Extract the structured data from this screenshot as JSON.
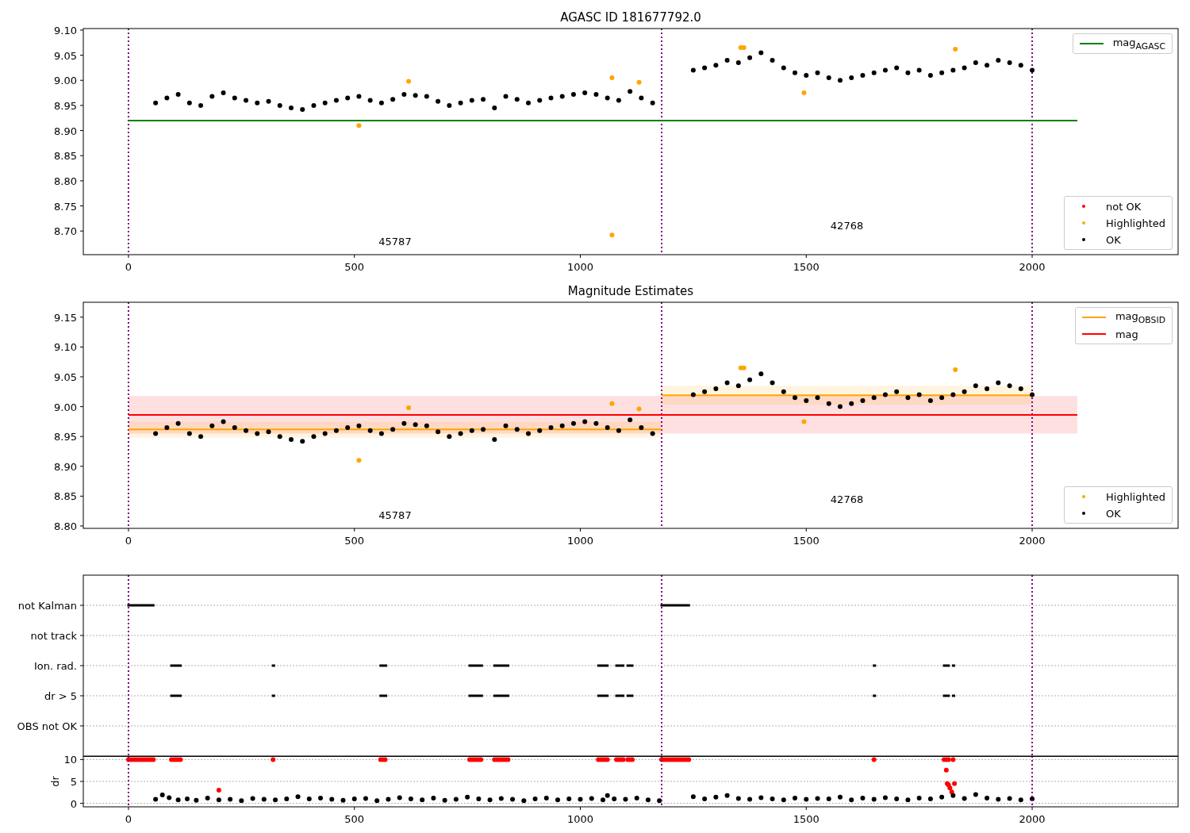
{
  "figure": {
    "panels": [
      {
        "title": "AGASC ID 181677792.0",
        "chart_data": {
          "type": "scatter",
          "legend": [
            "upper right",
            "lower right"
          ],
          "xlim": [
            -100,
            2323
          ],
          "ylim": [
            8.653,
            9.103
          ],
          "xticks": [
            0,
            500,
            1000,
            1500,
            2000
          ],
          "yticks": [
            {
              "value": 8.7,
              "label": "8.70"
            },
            {
              "value": 8.75,
              "label": "8.75"
            },
            {
              "value": 8.8,
              "label": "8.80"
            },
            {
              "value": 8.85,
              "label": "8.85"
            },
            {
              "value": 8.9,
              "label": "8.90"
            },
            {
              "value": 8.95,
              "label": "8.95"
            },
            {
              "value": 9.0,
              "label": "9.00"
            },
            {
              "value": 9.05,
              "label": "9.05"
            },
            {
              "value": 9.1,
              "label": "9.10"
            }
          ],
          "series": [
            {
              "name": "mag$_{AGASC}$",
              "type": "line",
              "color": "#008000",
              "x": [
                0,
                2100
              ],
              "values": [
                8.92,
                8.92
              ]
            },
            {
              "name": "not OK",
              "color": "#ff0000"
            },
            {
              "name": "Highlighted",
              "color": "#ffa500",
              "x": [
                510,
                620,
                1070,
                1070,
                1130,
                1355,
                1362,
                1495,
                1830
              ],
              "values": [
                8.91,
                8.998,
                9.005,
                8.692,
                8.996,
                9.065,
                9.065,
                8.975,
                9.062
              ]
            },
            {
              "name": "OK",
              "color": "#000000",
              "x": [
                60,
                85,
                110,
                135,
                160,
                185,
                210,
                235,
                260,
                285,
                310,
                335,
                360,
                385,
                410,
                435,
                460,
                485,
                510,
                535,
                560,
                585,
                610,
                635,
                660,
                685,
                710,
                735,
                760,
                785,
                810,
                835,
                860,
                885,
                910,
                935,
                960,
                985,
                1010,
                1035,
                1060,
                1085,
                1110,
                1135,
                1160,
                1250,
                1275,
                1300,
                1325,
                1350,
                1375,
                1400,
                1425,
                1450,
                1475,
                1500,
                1525,
                1550,
                1575,
                1600,
                1625,
                1650,
                1675,
                1700,
                1725,
                1750,
                1775,
                1800,
                1825,
                1850,
                1875,
                1900,
                1925,
                1950,
                1975,
                2000
              ],
              "values": [
                8.955,
                8.965,
                8.972,
                8.955,
                8.95,
                8.968,
                8.975,
                8.965,
                8.96,
                8.955,
                8.958,
                8.95,
                8.945,
                8.942,
                8.95,
                8.955,
                8.96,
                8.965,
                8.968,
                8.96,
                8.955,
                8.962,
                8.972,
                8.97,
                8.968,
                8.958,
                8.95,
                8.955,
                8.96,
                8.962,
                8.945,
                8.968,
                8.962,
                8.955,
                8.96,
                8.965,
                8.968,
                8.972,
                8.975,
                8.972,
                8.965,
                8.96,
                8.978,
                8.965,
                8.955,
                9.02,
                9.025,
                9.03,
                9.04,
                9.035,
                9.045,
                9.055,
                9.04,
                9.025,
                9.015,
                9.01,
                9.015,
                9.005,
                9.0,
                9.005,
                9.01,
                9.015,
                9.02,
                9.025,
                9.015,
                9.02,
                9.01,
                9.015,
                9.02,
                9.025,
                9.035,
                9.03,
                9.04,
                9.035,
                9.03,
                9.02
              ]
            }
          ],
          "ref_lines": [
            {
              "axis": "x",
              "value": 0,
              "color": "#800080"
            },
            {
              "axis": "x",
              "value": 1180,
              "color": "#800080"
            },
            {
              "axis": "x",
              "value": 2000,
              "color": "#800080"
            }
          ],
          "annotations": [
            "45787",
            "42768"
          ]
        }
      },
      {
        "title": "Magnitude Estimates",
        "chart_data": {
          "type": "scatter",
          "legend": [
            "upper right",
            "lower right"
          ],
          "xlim": [
            -100,
            2323
          ],
          "ylim": [
            8.796,
            9.175
          ],
          "xticks": [
            0,
            500,
            1000,
            1500,
            2000
          ],
          "yticks": [
            {
              "value": 8.8,
              "label": "8.80"
            },
            {
              "value": 8.85,
              "label": "8.85"
            },
            {
              "value": 8.9,
              "label": "8.90"
            },
            {
              "value": 8.95,
              "label": "8.95"
            },
            {
              "value": 9.0,
              "label": "9.00"
            },
            {
              "value": 9.05,
              "label": "9.05"
            },
            {
              "value": 9.1,
              "label": "9.10"
            },
            {
              "value": 9.15,
              "label": "9.15"
            }
          ],
          "series": [
            {
              "name": "mag$_{OBSID}$",
              "type": "line",
              "color": "#ffa500",
              "x": [
                0,
                1180,
                1180,
                2000
              ],
              "values": [
                8.962,
                8.962,
                9.019,
                9.019
              ]
            },
            {
              "name": "mag",
              "type": "line",
              "color": "#ff0000",
              "x": [
                0,
                2100
              ],
              "values": [
                8.986,
                8.986
              ]
            },
            {
              "name": "Highlighted",
              "color": "#ffa500",
              "x": [
                510,
                620,
                1070,
                1130,
                1355,
                1362,
                1495,
                1830
              ],
              "values": [
                8.91,
                8.998,
                9.005,
                8.996,
                9.065,
                9.065,
                8.975,
                9.062
              ]
            },
            {
              "name": "OK",
              "color": "#000000",
              "x": [
                60,
                85,
                110,
                135,
                160,
                185,
                210,
                235,
                260,
                285,
                310,
                335,
                360,
                385,
                410,
                435,
                460,
                485,
                510,
                535,
                560,
                585,
                610,
                635,
                660,
                685,
                710,
                735,
                760,
                785,
                810,
                835,
                860,
                885,
                910,
                935,
                960,
                985,
                1010,
                1035,
                1060,
                1085,
                1110,
                1135,
                1160,
                1250,
                1275,
                1300,
                1325,
                1350,
                1375,
                1400,
                1425,
                1450,
                1475,
                1500,
                1525,
                1550,
                1575,
                1600,
                1625,
                1650,
                1675,
                1700,
                1725,
                1750,
                1775,
                1800,
                1825,
                1850,
                1875,
                1900,
                1925,
                1950,
                1975,
                2000
              ],
              "values": [
                8.955,
                8.965,
                8.972,
                8.955,
                8.95,
                8.968,
                8.975,
                8.965,
                8.96,
                8.955,
                8.958,
                8.95,
                8.945,
                8.942,
                8.95,
                8.955,
                8.96,
                8.965,
                8.968,
                8.96,
                8.955,
                8.962,
                8.972,
                8.97,
                8.968,
                8.958,
                8.95,
                8.955,
                8.96,
                8.962,
                8.945,
                8.968,
                8.962,
                8.955,
                8.96,
                8.965,
                8.968,
                8.972,
                8.975,
                8.972,
                8.965,
                8.96,
                8.978,
                8.965,
                8.955,
                9.02,
                9.025,
                9.03,
                9.04,
                9.035,
                9.045,
                9.055,
                9.04,
                9.025,
                9.015,
                9.01,
                9.015,
                9.005,
                9.0,
                9.005,
                9.01,
                9.015,
                9.02,
                9.025,
                9.015,
                9.02,
                9.01,
                9.015,
                9.02,
                9.025,
                9.035,
                9.03,
                9.04,
                9.035,
                9.03,
                9.02
              ]
            }
          ],
          "bands": [
            {
              "axis": "y",
              "from": 8.955,
              "to": 9.018,
              "color": "#ff0000"
            },
            {
              "axis": "y",
              "from": 8.948,
              "to": 8.975,
              "color": "#ffa500"
            },
            {
              "axis": "y",
              "from": 9.003,
              "to": 9.035,
              "color": "#ffa500"
            }
          ],
          "ref_lines": [
            {
              "axis": "x",
              "value": 0,
              "color": "#800080"
            },
            {
              "axis": "x",
              "value": 1180,
              "color": "#800080"
            },
            {
              "axis": "x",
              "value": 2000,
              "color": "#800080"
            }
          ],
          "annotations": [
            "45787",
            "42768"
          ]
        }
      }
    ],
    "flags": {
      "labels": [
        "not Kalman",
        "not track",
        "Ion. rad.",
        "dr > 5",
        "OBS not OK"
      ]
    },
    "dr": {
      "chart_data": {
        "type": "scatter",
        "grid": true,
        "ylabel": "dr",
        "xlim": [
          -100,
          2323
        ],
        "ylim": [
          -0.8,
          10.8
        ],
        "xticks": [
          0,
          500,
          1000,
          1500,
          2000
        ],
        "yticks": [
          0,
          5,
          10
        ],
        "series": [
          {
            "color": "#ff0000",
            "x": [
              0,
              5,
              10,
              15,
              20,
              25,
              30,
              35,
              40,
              45,
              50,
              55,
              95,
              100,
              105,
              110,
              115,
              320,
              558,
              563,
              568,
              755,
              760,
              765,
              770,
              775,
              780,
              810,
              815,
              820,
              825,
              830,
              835,
              840,
              1040,
              1045,
              1050,
              1055,
              1060,
              1080,
              1085,
              1090,
              1095,
              1105,
              1110,
              1115,
              1180,
              1185,
              1190,
              1195,
              1200,
              1205,
              1210,
              1215,
              1220,
              1225,
              1230,
              1235,
              1240,
              1650,
              1805,
              1810,
              1815,
              1825,
              200,
              1810,
              1812,
              1815,
              1818,
              1822,
              1828
            ],
            "values": [
              10,
              10,
              10,
              10,
              10,
              10,
              10,
              10,
              10,
              10,
              10,
              10,
              10,
              10,
              10,
              10,
              10,
              10,
              10,
              10,
              10,
              10,
              10,
              10,
              10,
              10,
              10,
              10,
              10,
              10,
              10,
              10,
              10,
              10,
              10,
              10,
              10,
              10,
              10,
              10,
              10,
              10,
              10,
              10,
              10,
              10,
              10,
              10,
              10,
              10,
              10,
              10,
              10,
              10,
              10,
              10,
              10,
              10,
              10,
              10,
              10,
              10,
              10,
              10,
              3,
              7.6,
              4.5,
              4.2,
              3.5,
              2.6,
              4.5
            ]
          },
          {
            "color": "#000000",
            "x": [
              60,
              75,
              90,
              110,
              130,
              150,
              175,
              200,
              225,
              250,
              275,
              300,
              325,
              350,
              375,
              400,
              425,
              450,
              475,
              500,
              525,
              550,
              575,
              600,
              625,
              650,
              675,
              700,
              725,
              750,
              775,
              800,
              825,
              850,
              875,
              900,
              925,
              950,
              975,
              1000,
              1025,
              1050,
              1060,
              1075,
              1100,
              1125,
              1150,
              1175,
              1250,
              1275,
              1300,
              1325,
              1350,
              1375,
              1400,
              1425,
              1450,
              1475,
              1500,
              1525,
              1550,
              1575,
              1600,
              1625,
              1650,
              1675,
              1700,
              1725,
              1750,
              1775,
              1800,
              1825,
              1850,
              1875,
              1900,
              1925,
              1950,
              1975,
              2000
            ],
            "values": [
              0.9,
              1.9,
              1.3,
              0.8,
              1.0,
              0.7,
              1.2,
              0.8,
              0.9,
              0.6,
              1.1,
              0.9,
              0.8,
              1.0,
              1.5,
              1.0,
              1.2,
              0.9,
              0.7,
              1.0,
              1.1,
              0.6,
              0.9,
              1.3,
              1.0,
              0.8,
              1.2,
              0.7,
              0.9,
              1.4,
              1.0,
              0.8,
              1.1,
              0.9,
              0.6,
              1.0,
              1.2,
              0.8,
              1.0,
              0.9,
              1.1,
              0.8,
              1.8,
              1.0,
              0.9,
              1.2,
              0.8,
              0.6,
              1.5,
              1.0,
              1.4,
              1.8,
              1.1,
              0.9,
              1.3,
              1.0,
              0.8,
              1.2,
              0.9,
              1.1,
              1.0,
              1.4,
              0.8,
              1.2,
              0.9,
              1.3,
              1.0,
              0.8,
              1.2,
              1.0,
              1.4,
              1.8,
              1.1,
              2.0,
              1.2,
              0.9,
              1.1,
              0.8,
              1.0
            ]
          }
        ],
        "ref_lines": [
          {
            "axis": "x",
            "value": 0,
            "color": "#800080"
          },
          {
            "axis": "x",
            "value": 1180,
            "color": "#800080"
          },
          {
            "axis": "x",
            "value": 2000,
            "color": "#800080"
          }
        ]
      }
    }
  }
}
